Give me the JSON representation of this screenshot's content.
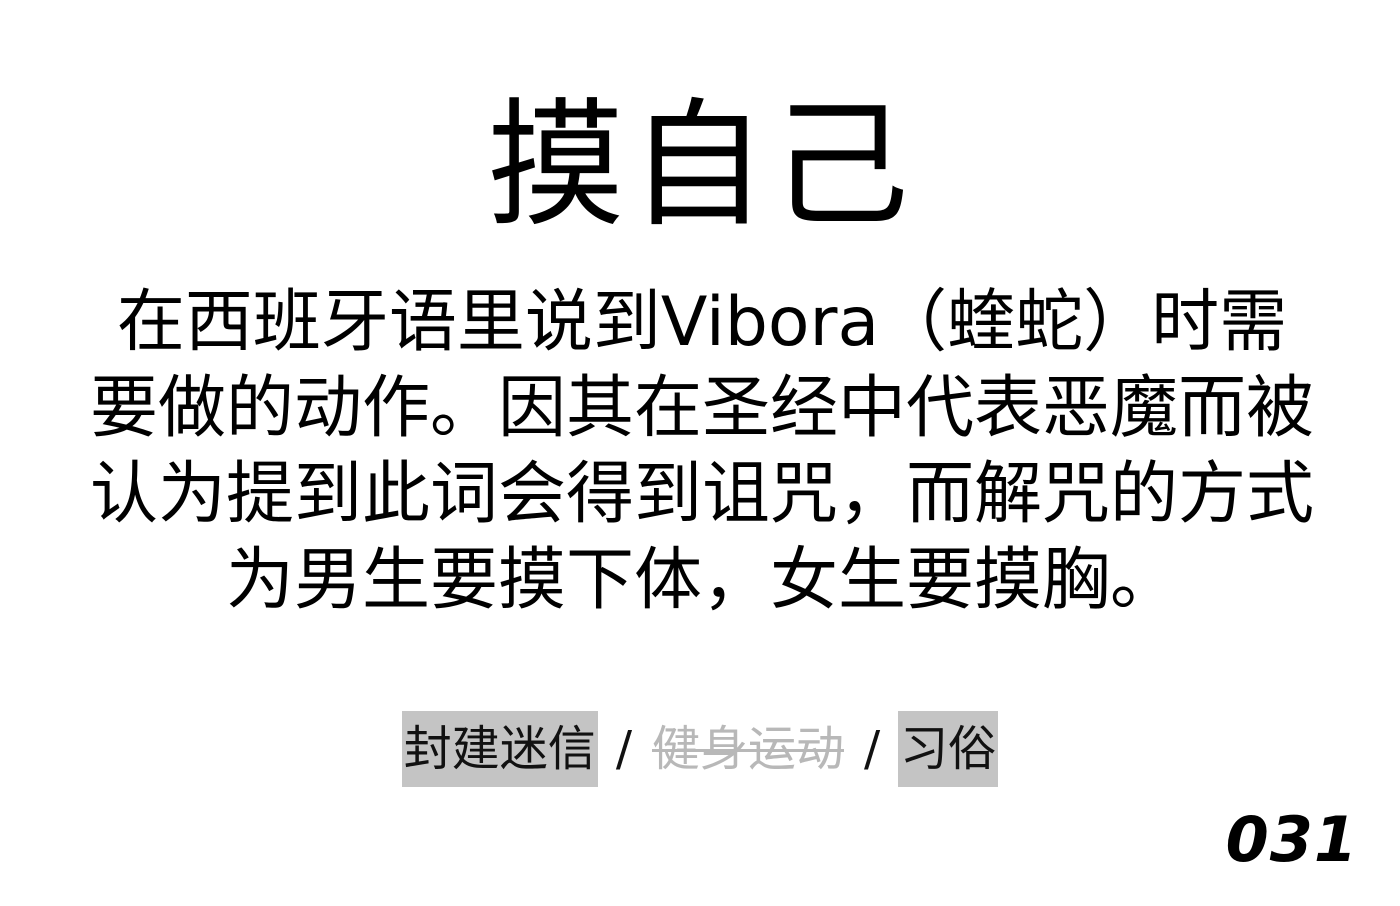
{
  "title": "摸自己",
  "description": "在西班牙语里说到Vibora（蝰蛇）时需要做的动作。因其在圣经中代表恶魔而被认为提到此词会得到诅咒，而解咒的方式为男生要摸下体，女生要摸胸。",
  "tags": [
    {
      "label": "封建迷信",
      "state": "highlighted"
    },
    {
      "label": "健身运动",
      "state": "struck-through"
    },
    {
      "label": "习俗",
      "state": "highlighted"
    }
  ],
  "separator": "/",
  "page_number": "031",
  "colors": {
    "background": "#ffffff",
    "text": "#000000",
    "tag_highlight": "#c4c4c4",
    "tag_struck": "#b8b8b8"
  }
}
